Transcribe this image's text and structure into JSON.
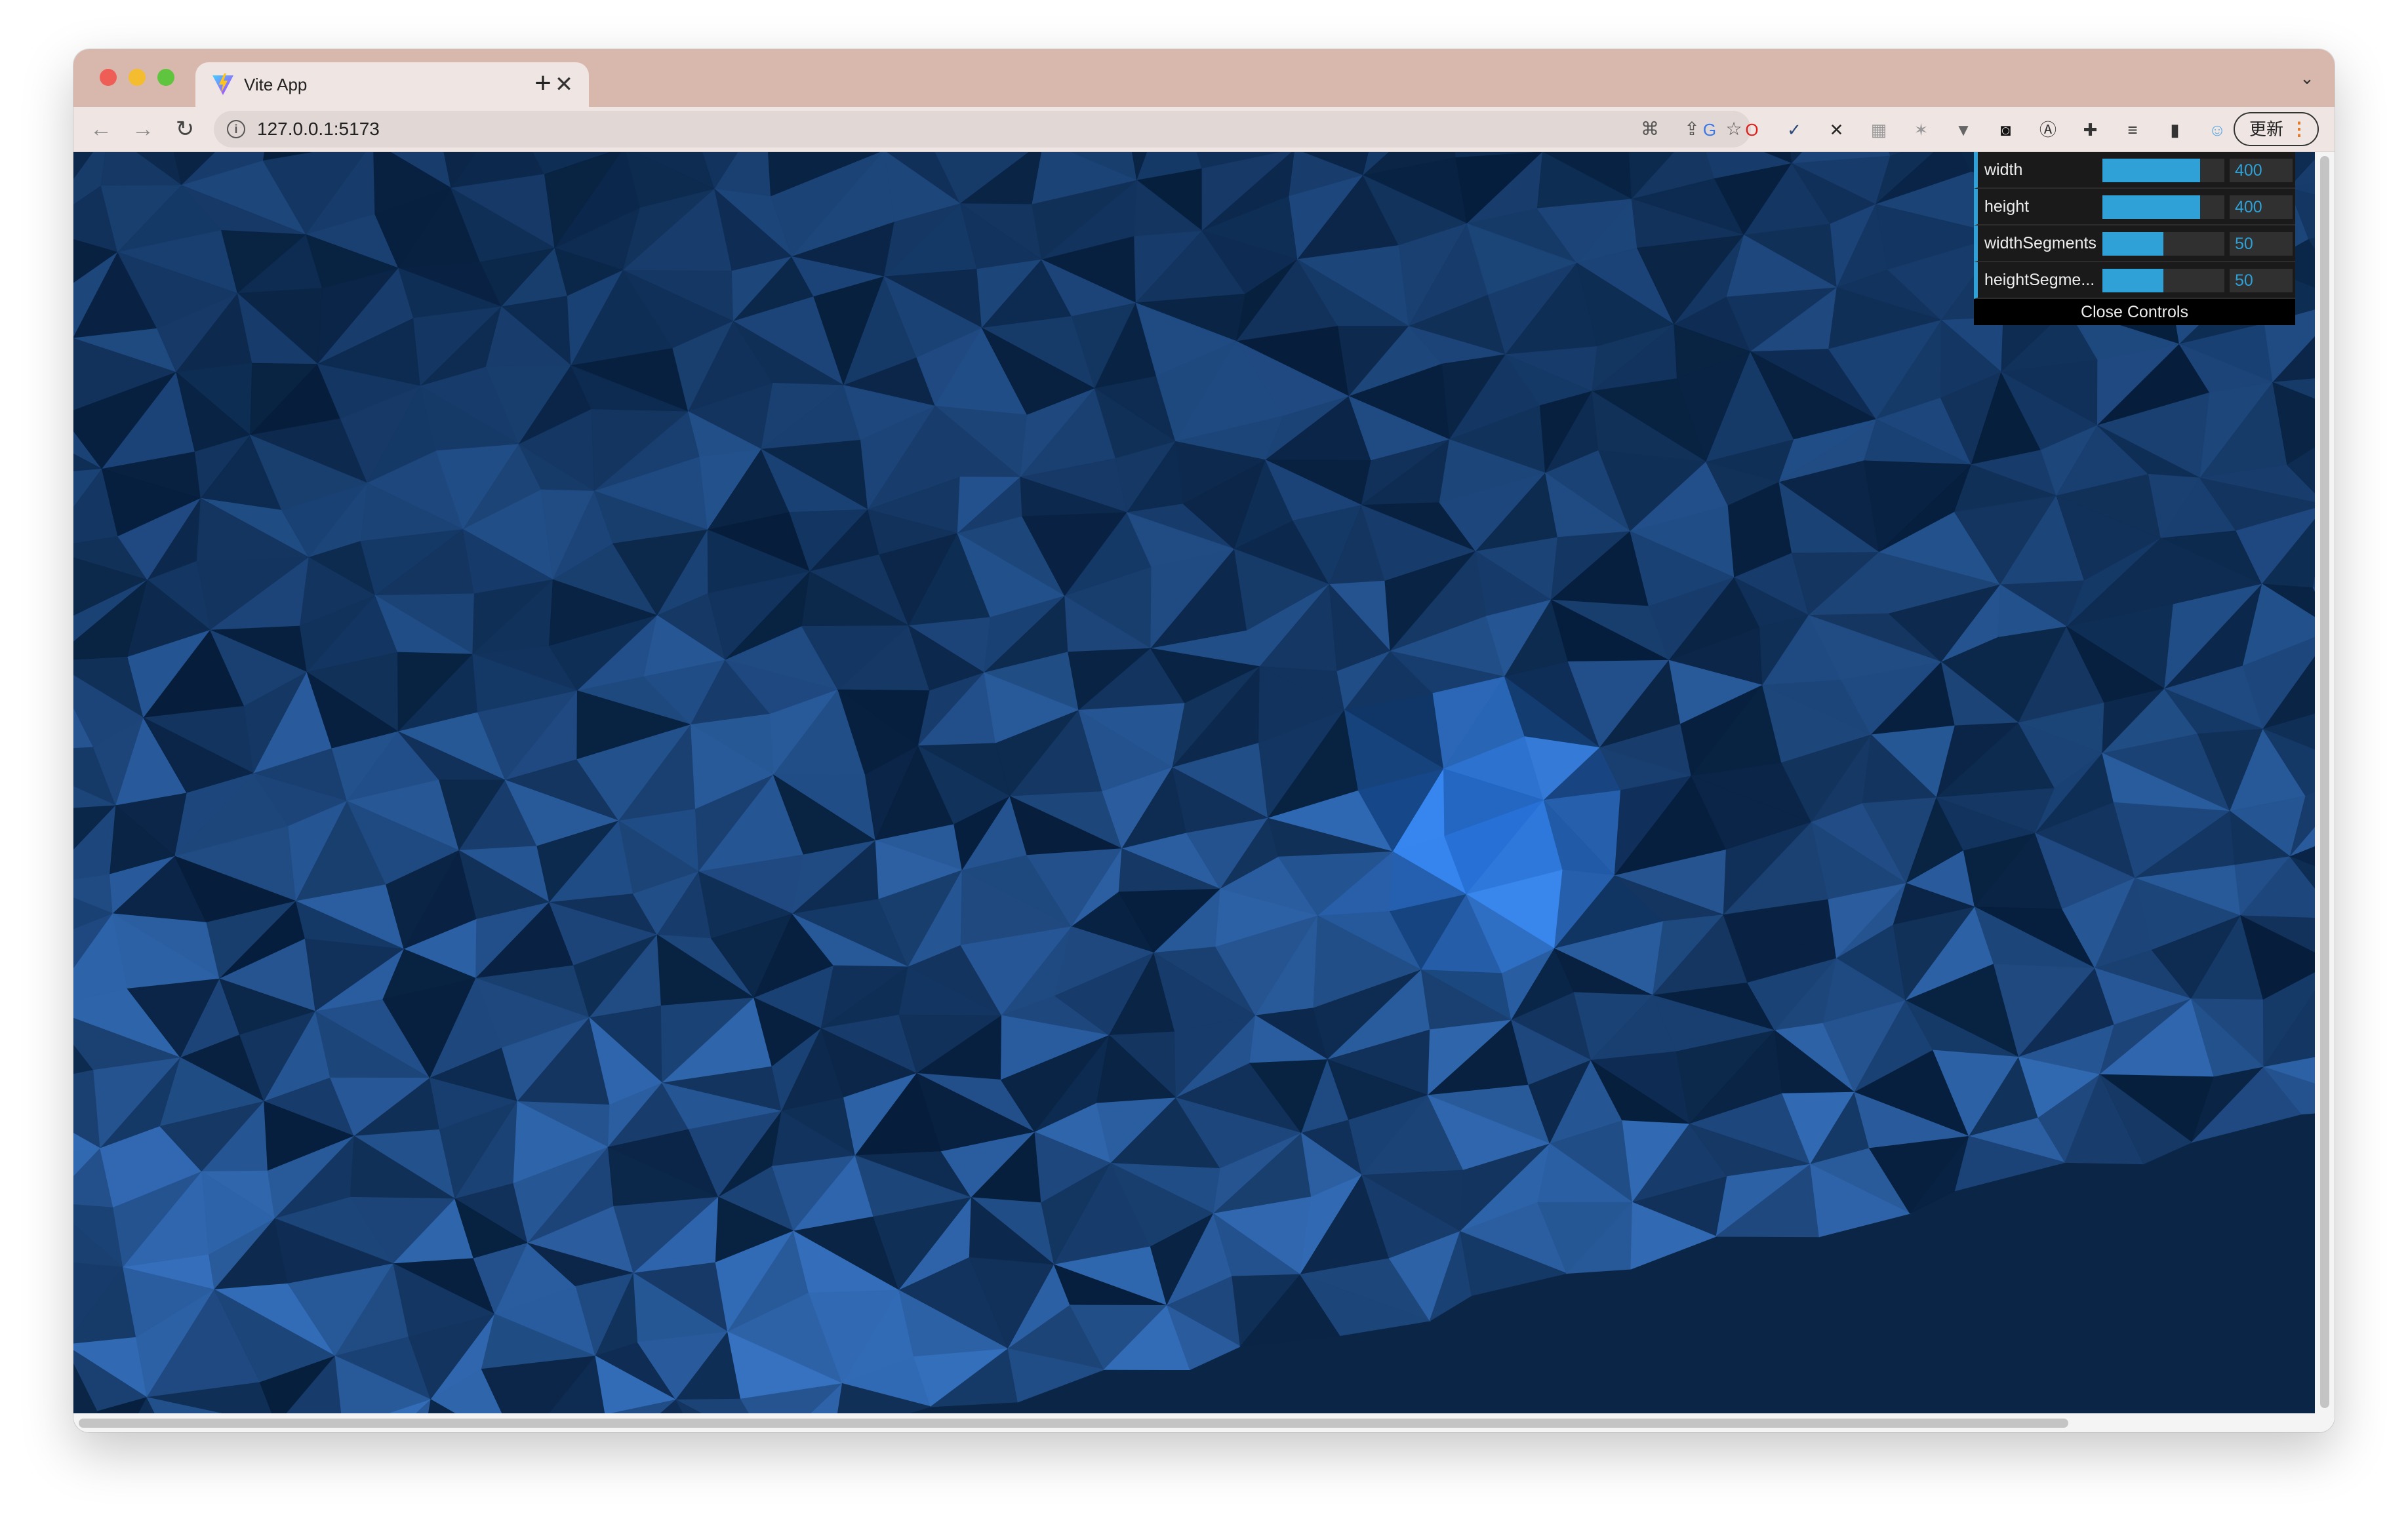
{
  "browser": {
    "tab": {
      "title": "Vite App",
      "favicon": "vite-logo-icon",
      "close_glyph": "✕"
    },
    "new_tab_glyph": "+",
    "tab_list_glyph": "⌄",
    "nav": {
      "back_glyph": "←",
      "forward_glyph": "→",
      "reload_glyph": "↻"
    },
    "address": {
      "url": "127.0.0.1:5173",
      "info_glyph": "i"
    },
    "omnibox_icons": [
      {
        "name": "translate-icon",
        "glyph": "⌘"
      },
      {
        "name": "share-icon",
        "glyph": "⇪"
      },
      {
        "name": "bookmark-star-icon",
        "glyph": "☆"
      }
    ],
    "extensions": [
      {
        "name": "google-translate-extension-icon",
        "glyph": "G",
        "color": "#3b78e7"
      },
      {
        "name": "opera-extension-icon",
        "glyph": "O",
        "color": "#e0201b"
      },
      {
        "name": "checkmark-extension-icon",
        "glyph": "✓",
        "color": "#2a4b7c"
      },
      {
        "name": "x-extension-icon",
        "glyph": "✕",
        "color": "#222222"
      },
      {
        "name": "grid-extension-icon",
        "glyph": "▦",
        "color": "#999999"
      },
      {
        "name": "sparkle-extension-icon",
        "glyph": "✶",
        "color": "#999999"
      },
      {
        "name": "vue-devtools-extension-icon",
        "glyph": "▼",
        "color": "#666666"
      },
      {
        "name": "mask-extension-icon",
        "glyph": "◙",
        "color": "#111111"
      },
      {
        "name": "a-circle-extension-icon",
        "glyph": "Ⓐ",
        "color": "#333333"
      },
      {
        "name": "puzzle-extensions-icon",
        "glyph": "✚",
        "color": "#333333"
      },
      {
        "name": "reading-list-icon",
        "glyph": "≡",
        "color": "#333333"
      },
      {
        "name": "side-panel-icon",
        "glyph": "▮",
        "color": "#333333"
      },
      {
        "name": "profile-avatar-icon",
        "glyph": "☺",
        "color": "#5aa9e6"
      }
    ],
    "update_button": {
      "label": "更新",
      "menu_glyph": "⋮"
    }
  },
  "gui": {
    "controls": [
      {
        "label": "width",
        "value": "400",
        "fill": 0.8
      },
      {
        "label": "height",
        "value": "400",
        "fill": 0.8
      },
      {
        "label": "widthSegments",
        "value": "50",
        "fill": 0.5
      },
      {
        "label": "heightSegme...",
        "value": "50",
        "fill": 0.5
      }
    ],
    "close_label": "Close Controls"
  },
  "scene": {
    "base_color": "#0a2546",
    "highlight_color": "#2b6fd1"
  }
}
